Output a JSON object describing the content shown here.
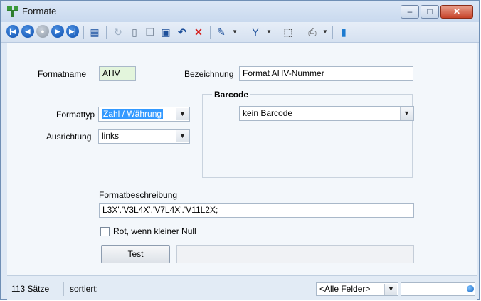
{
  "window": {
    "title": "Formate",
    "minimize": "‒",
    "maximize": "□",
    "close": "✕"
  },
  "toolbar": {
    "icons": [
      "first-record-icon",
      "previous-record-icon",
      "refresh-record-icon",
      "next-record-icon",
      "last-record-icon",
      "table-view-icon",
      "reload-icon",
      "new-record-icon",
      "copy-record-icon",
      "save-icon",
      "undo-icon",
      "delete-icon",
      "edit-tools-icon",
      "filter-icon",
      "select-cursor-icon",
      "print-icon",
      "exit-icon"
    ]
  },
  "form": {
    "formatname_label": "Formatname",
    "formatname_value": "AHV",
    "bezeichnung_label": "Bezeichnung",
    "bezeichnung_value": "Format AHV-Nummer",
    "formattyp_label": "Formattyp",
    "formattyp_value": "Zahl / Währung",
    "ausrichtung_label": "Ausrichtung",
    "ausrichtung_value": "links",
    "barcode_title": "Barcode",
    "barcode_value": "kein Barcode",
    "beschreibung_label": "Formatbeschreibung",
    "beschreibung_value": "L3X'.'V3L4X'.'V7L4X'.'V11L2X;",
    "rot_label": "Rot, wenn kleiner Null",
    "test_button": "Test",
    "test_output": ""
  },
  "status": {
    "count": "113 Sätze",
    "sort": "sortiert:",
    "field_filter": "<Alle Felder>",
    "search_value": ""
  },
  "colors": {
    "formatname_bg": "#e3f5dc",
    "formattyp_selected_bg": "#3399ff"
  }
}
